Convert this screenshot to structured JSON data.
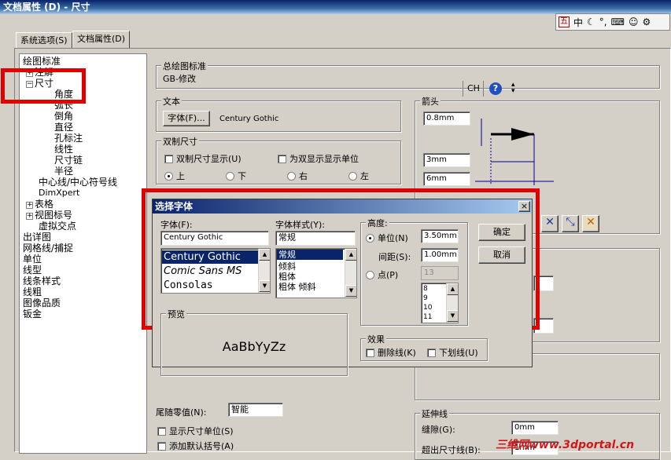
{
  "window": {
    "title": "文档属性 (D) - 尺寸"
  },
  "ime": {
    "lang": "中",
    "moon": "☾",
    "dots": "°,",
    "kbd": "⌨",
    "person": "☺",
    "wrench": "⚙"
  },
  "tabs": [
    {
      "label": "系统选项(S)"
    },
    {
      "label": "文档属性(D)"
    }
  ],
  "tree": {
    "items": [
      {
        "label": "绘图标准"
      },
      {
        "label": "注解"
      },
      {
        "label": "尺寸"
      },
      {
        "label": "角度"
      },
      {
        "label": "弧长"
      },
      {
        "label": "倒角"
      },
      {
        "label": "直径"
      },
      {
        "label": "孔标注"
      },
      {
        "label": "线性"
      },
      {
        "label": "尺寸链"
      },
      {
        "label": "半径"
      },
      {
        "label": "中心线/中心符号线"
      },
      {
        "label": "DimXpert"
      },
      {
        "label": "表格"
      },
      {
        "label": "视图标号"
      },
      {
        "label": "虚拟交点"
      },
      {
        "label": "出详图"
      },
      {
        "label": "网格线/捕捉"
      },
      {
        "label": "单位"
      },
      {
        "label": "线型"
      },
      {
        "label": "线条样式"
      },
      {
        "label": "线粗"
      },
      {
        "label": "图像品质"
      },
      {
        "label": "钣金"
      }
    ]
  },
  "standard": {
    "label": "总绘图标准",
    "value": "GB-修改"
  },
  "ch_label": "CH",
  "text_group": {
    "label": "文本",
    "font_button": "字体(F)...",
    "font_name": "Century Gothic"
  },
  "dual": {
    "label": "双制尺寸",
    "show": "双制尺寸显示(U)",
    "show_units": "为双显示显示单位",
    "radios": [
      {
        "label": "上"
      },
      {
        "label": "下"
      },
      {
        "label": "右"
      },
      {
        "label": "左"
      }
    ]
  },
  "arrow": {
    "label": "箭头",
    "v1": "0.8mm",
    "v2": "3mm",
    "v3": "6mm"
  },
  "bottom": {
    "offset_label": "尾随零值(N):",
    "offset_value": "智能",
    "show_units": "显示尺寸单位(S)",
    "add_default": "添加默认括号(A)"
  },
  "ext": {
    "label": "延伸线",
    "gap_label": "缝隙(G):",
    "gap_value": "0mm",
    "beyond_label": "超出尺寸线(B):",
    "beyond_value": "1mm"
  },
  "dialog": {
    "title": "选择字体",
    "close": "×",
    "font_label": "字体(F):",
    "font_value": "Century Gothic",
    "fonts": [
      {
        "label": "Century Gothic"
      },
      {
        "label": "Comic Sans MS"
      },
      {
        "label": "Consolas"
      }
    ],
    "style_label": "字体样式(Y):",
    "style_value": "常规",
    "styles": [
      {
        "label": "常规"
      },
      {
        "label": "倾斜"
      },
      {
        "label": "粗体"
      },
      {
        "label": "粗体 倾斜"
      }
    ],
    "height_label": "高度:",
    "unit_label": "单位(N)",
    "unit_value": "3.50mm",
    "spacing_label": "间距(S):",
    "spacing_value": "1.00mm",
    "point_label": "点(P)",
    "point_value": "13",
    "points": [
      {
        "label": "8"
      },
      {
        "label": "9"
      },
      {
        "label": "10"
      },
      {
        "label": "11"
      }
    ],
    "ok": "确定",
    "cancel": "取消",
    "preview_label": "预览",
    "preview_text": "AaBbYyZz",
    "effects_label": "效果",
    "strike_label": "删除线(K)",
    "underline_label": "下划线(U)"
  },
  "watermark": "三维网www.3dportal.cn",
  "colors": {
    "highlight": "#e00000",
    "selection": "#0a246a"
  }
}
